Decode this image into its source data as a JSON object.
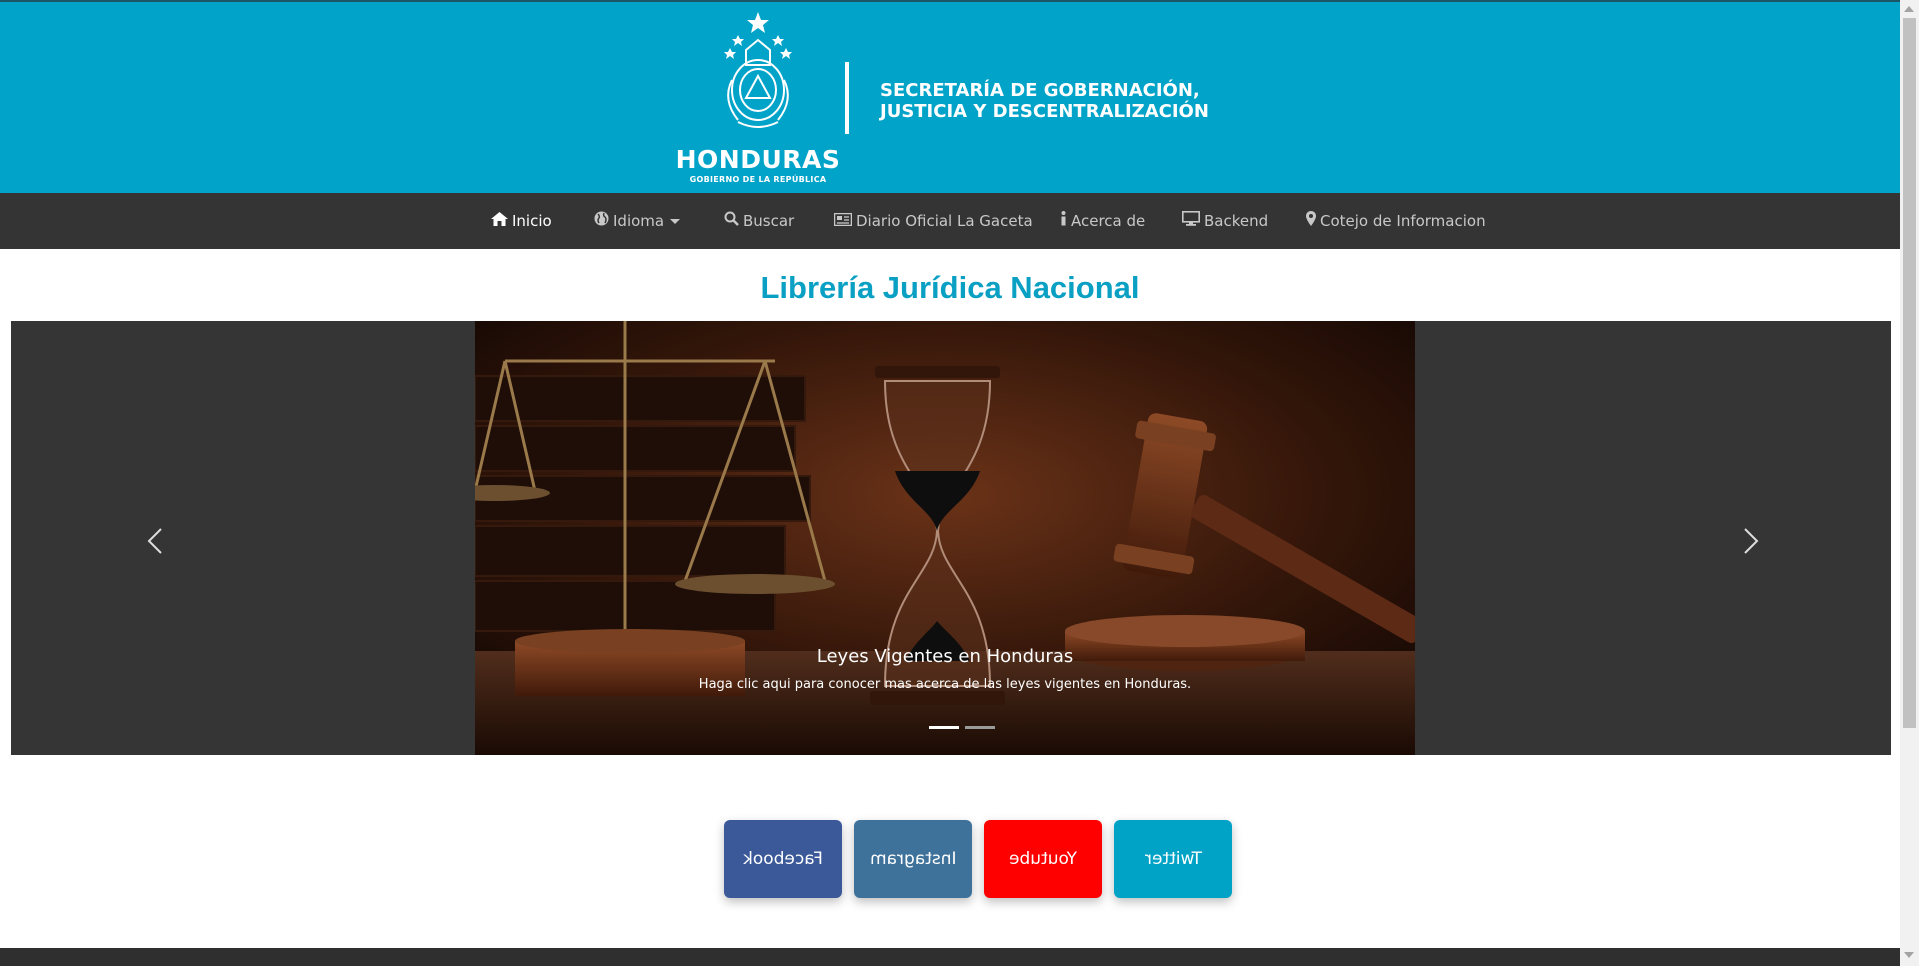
{
  "header": {
    "country": "HONDURAS",
    "gobierno": "GOBIERNO DE LA REPÚBLICA",
    "secretaria_line1": "SECRETARÍA DE GOBERNACIÓN,",
    "secretaria_line2": "JUSTICIA Y DESCENTRALIZACIÓN",
    "brand_color": "#02a3c8"
  },
  "nav": {
    "items": [
      {
        "label": "Inicio",
        "icon": "home-icon",
        "active": true
      },
      {
        "label": "Idioma",
        "icon": "globe-icon",
        "dropdown": true
      },
      {
        "label": "Buscar",
        "icon": "search-icon"
      },
      {
        "label": "Diario Oficial La Gaceta",
        "icon": "newspaper-icon"
      },
      {
        "label": "Acerca de",
        "icon": "info-icon"
      },
      {
        "label": "Backend",
        "icon": "desktop-icon"
      },
      {
        "label": "Cotejo de Informacion",
        "icon": "map-marker-icon"
      }
    ]
  },
  "main": {
    "title": "Librería Jurídica Nacional"
  },
  "carousel": {
    "slide_title": "Leyes Vigentes en Honduras",
    "slide_text": "Haga clic aqui para conocer mas acerca de las leyes vigentes en Honduras.",
    "active_index": 0,
    "slide_count": 2,
    "prev_icon": "chevron-left-icon",
    "next_icon": "chevron-right-icon"
  },
  "social": [
    {
      "label": "Facebook",
      "color": "#3b5998"
    },
    {
      "label": "Instagram",
      "color": "#3f729b"
    },
    {
      "label": "Youtube",
      "color": "#ff0000"
    },
    {
      "label": "Twitter",
      "color": "#00a2c6"
    }
  ]
}
